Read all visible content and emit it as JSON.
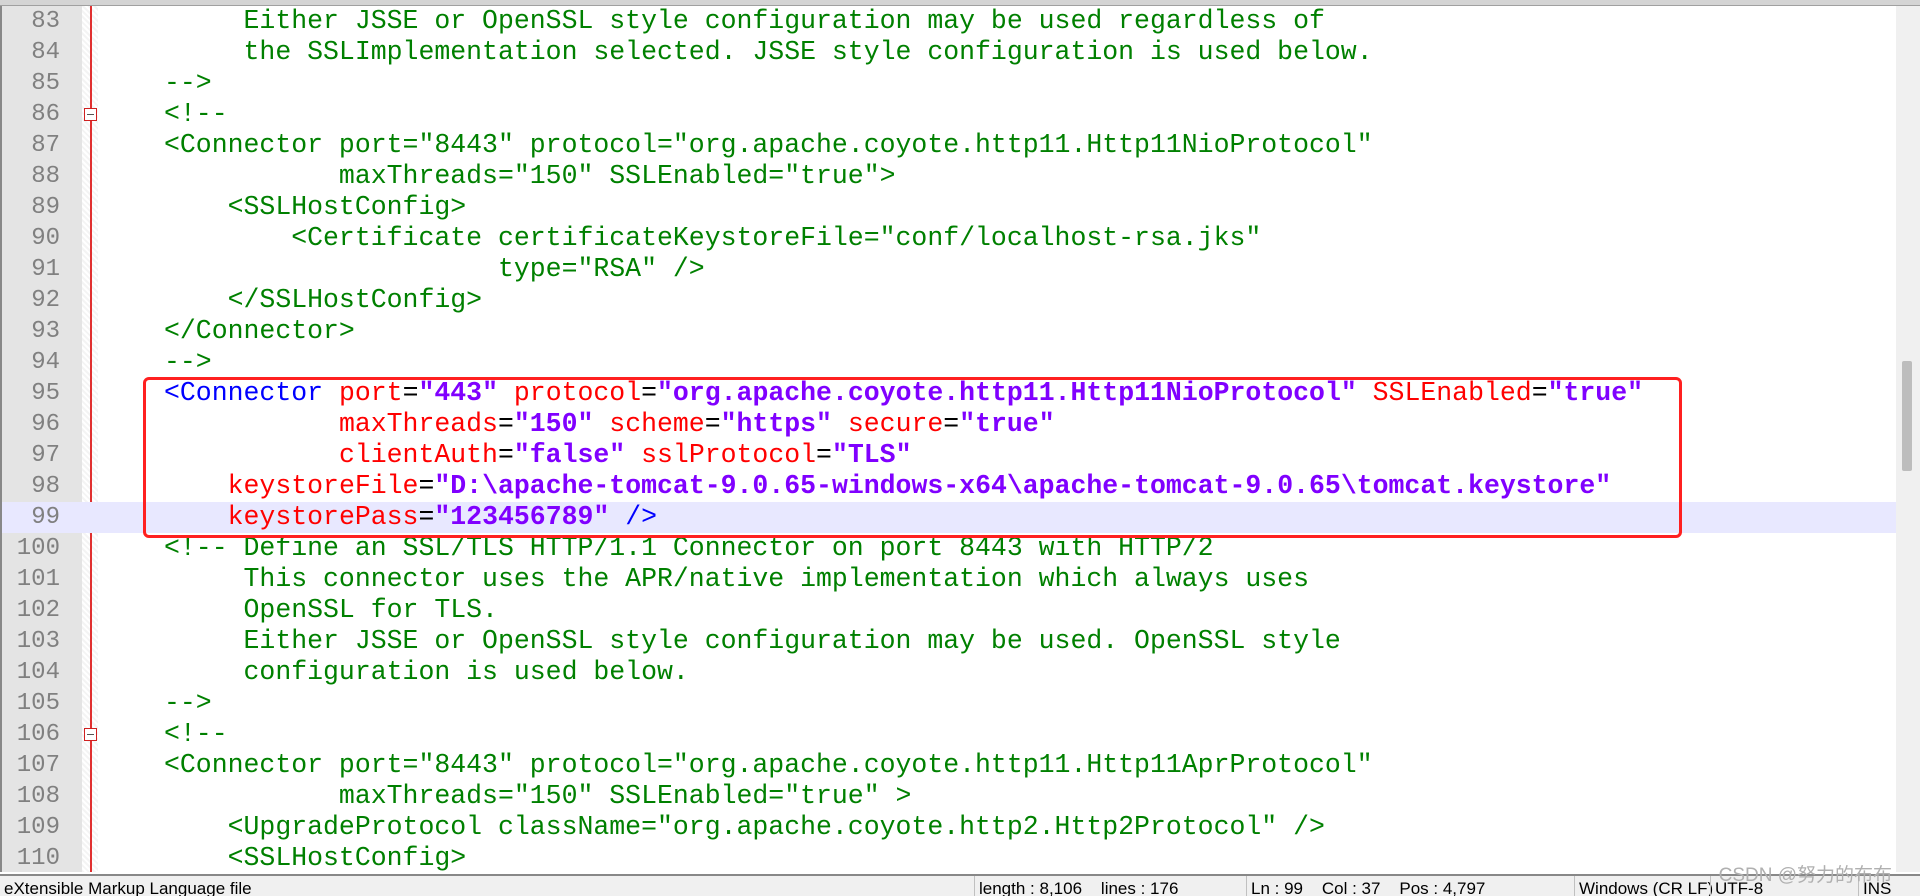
{
  "editor": {
    "current_line": 99,
    "folded_lines": [
      86,
      106
    ],
    "highlight_box_lines": [
      95,
      99
    ],
    "colors": {
      "comment": "#008000",
      "tag": "#0000ff",
      "attribute": "#ff0000",
      "value": "#8000ff",
      "highlight_box": "#ff2020",
      "current_line": "#e8e8ff"
    },
    "lines": [
      {
        "n": "83",
        "tokens": [
          [
            "g",
            "     Either JSSE or OpenSSL style configuration may be used regardless of"
          ]
        ]
      },
      {
        "n": "84",
        "tokens": [
          [
            "g",
            "     the SSLImplementation selected. JSSE style configuration is used below."
          ]
        ]
      },
      {
        "n": "85",
        "tokens": [
          [
            "g",
            "-->"
          ]
        ]
      },
      {
        "n": "86",
        "tokens": [
          [
            "g",
            "<!--"
          ]
        ]
      },
      {
        "n": "87",
        "tokens": [
          [
            "g",
            "<Connector port=\"8443\" protocol=\"org.apache.coyote.http11.Http11NioProtocol\""
          ]
        ]
      },
      {
        "n": "88",
        "tokens": [
          [
            "g",
            "           maxThreads=\"150\" SSLEnabled=\"true\">"
          ]
        ]
      },
      {
        "n": "89",
        "tokens": [
          [
            "g",
            "    <SSLHostConfig>"
          ]
        ]
      },
      {
        "n": "90",
        "tokens": [
          [
            "g",
            "        <Certificate certificateKeystoreFile=\"conf/localhost-rsa.jks\""
          ]
        ]
      },
      {
        "n": "91",
        "tokens": [
          [
            "g",
            "                     type=\"RSA\" />"
          ]
        ]
      },
      {
        "n": "92",
        "tokens": [
          [
            "g",
            "    </SSLHostConfig>"
          ]
        ]
      },
      {
        "n": "93",
        "tokens": [
          [
            "g",
            "</Connector>"
          ]
        ]
      },
      {
        "n": "94",
        "tokens": [
          [
            "g",
            "-->"
          ]
        ]
      },
      {
        "n": "95",
        "tokens": [
          [
            "b",
            "<Connector"
          ],
          [
            "k",
            " "
          ],
          [
            "r",
            "port"
          ],
          [
            "k",
            "="
          ],
          [
            "v",
            "\"443\""
          ],
          [
            "k",
            " "
          ],
          [
            "r",
            "protocol"
          ],
          [
            "k",
            "="
          ],
          [
            "v",
            "\"org.apache.coyote.http11.Http11NioProtocol\""
          ],
          [
            "k",
            " "
          ],
          [
            "r",
            "SSLEnabled"
          ],
          [
            "k",
            "="
          ],
          [
            "v",
            "\"true\""
          ]
        ]
      },
      {
        "n": "96",
        "tokens": [
          [
            "k",
            "           "
          ],
          [
            "r",
            "maxThreads"
          ],
          [
            "k",
            "="
          ],
          [
            "v",
            "\"150\""
          ],
          [
            "k",
            " "
          ],
          [
            "r",
            "scheme"
          ],
          [
            "k",
            "="
          ],
          [
            "v",
            "\"https\""
          ],
          [
            "k",
            " "
          ],
          [
            "r",
            "secure"
          ],
          [
            "k",
            "="
          ],
          [
            "v",
            "\"true\""
          ]
        ]
      },
      {
        "n": "97",
        "tokens": [
          [
            "k",
            "           "
          ],
          [
            "r",
            "clientAuth"
          ],
          [
            "k",
            "="
          ],
          [
            "v",
            "\"false\""
          ],
          [
            "k",
            " "
          ],
          [
            "r",
            "sslProtocol"
          ],
          [
            "k",
            "="
          ],
          [
            "v",
            "\"TLS\""
          ]
        ]
      },
      {
        "n": "98",
        "tokens": [
          [
            "k",
            "    "
          ],
          [
            "r",
            "keystoreFile"
          ],
          [
            "k",
            "="
          ],
          [
            "v",
            "\"D:\\apache-tomcat-9.0.65-windows-x64\\apache-tomcat-9.0.65\\tomcat.keystore\""
          ]
        ]
      },
      {
        "n": "99",
        "tokens": [
          [
            "k",
            "    "
          ],
          [
            "r",
            "keystorePass"
          ],
          [
            "k",
            "="
          ],
          [
            "v",
            "\"123456789\""
          ],
          [
            "k",
            " "
          ],
          [
            "b",
            "/>"
          ]
        ]
      },
      {
        "n": "100",
        "tokens": [
          [
            "g",
            "<!-- Define an SSL/TLS HTTP/1.1 Connector on port 8443 with HTTP/2"
          ]
        ]
      },
      {
        "n": "101",
        "tokens": [
          [
            "g",
            "     This connector uses the APR/native implementation which always uses"
          ]
        ]
      },
      {
        "n": "102",
        "tokens": [
          [
            "g",
            "     OpenSSL for TLS."
          ]
        ]
      },
      {
        "n": "103",
        "tokens": [
          [
            "g",
            "     Either JSSE or OpenSSL style configuration may be used. OpenSSL style"
          ]
        ]
      },
      {
        "n": "104",
        "tokens": [
          [
            "g",
            "     configuration is used below."
          ]
        ]
      },
      {
        "n": "105",
        "tokens": [
          [
            "g",
            "-->"
          ]
        ]
      },
      {
        "n": "106",
        "tokens": [
          [
            "g",
            "<!--"
          ]
        ]
      },
      {
        "n": "107",
        "tokens": [
          [
            "g",
            "<Connector port=\"8443\" protocol=\"org.apache.coyote.http11.Http11AprProtocol\""
          ]
        ]
      },
      {
        "n": "108",
        "tokens": [
          [
            "g",
            "           maxThreads=\"150\" SSLEnabled=\"true\" >"
          ]
        ]
      },
      {
        "n": "109",
        "tokens": [
          [
            "g",
            "    <UpgradeProtocol className=\"org.apache.coyote.http2.Http2Protocol\" />"
          ]
        ]
      },
      {
        "n": "110",
        "tokens": [
          [
            "g",
            "    <SSLHostConfig>"
          ]
        ]
      }
    ]
  },
  "status": {
    "file_type": "eXtensible Markup Language file",
    "length_lines": "length : 8,106    lines : 176",
    "position": "Ln : 99    Col : 37    Pos : 4,797",
    "eol": "Windows (CR LF)",
    "encoding": "UTF-8",
    "mode": "INS"
  },
  "watermark": "CSDN @努力的布布"
}
